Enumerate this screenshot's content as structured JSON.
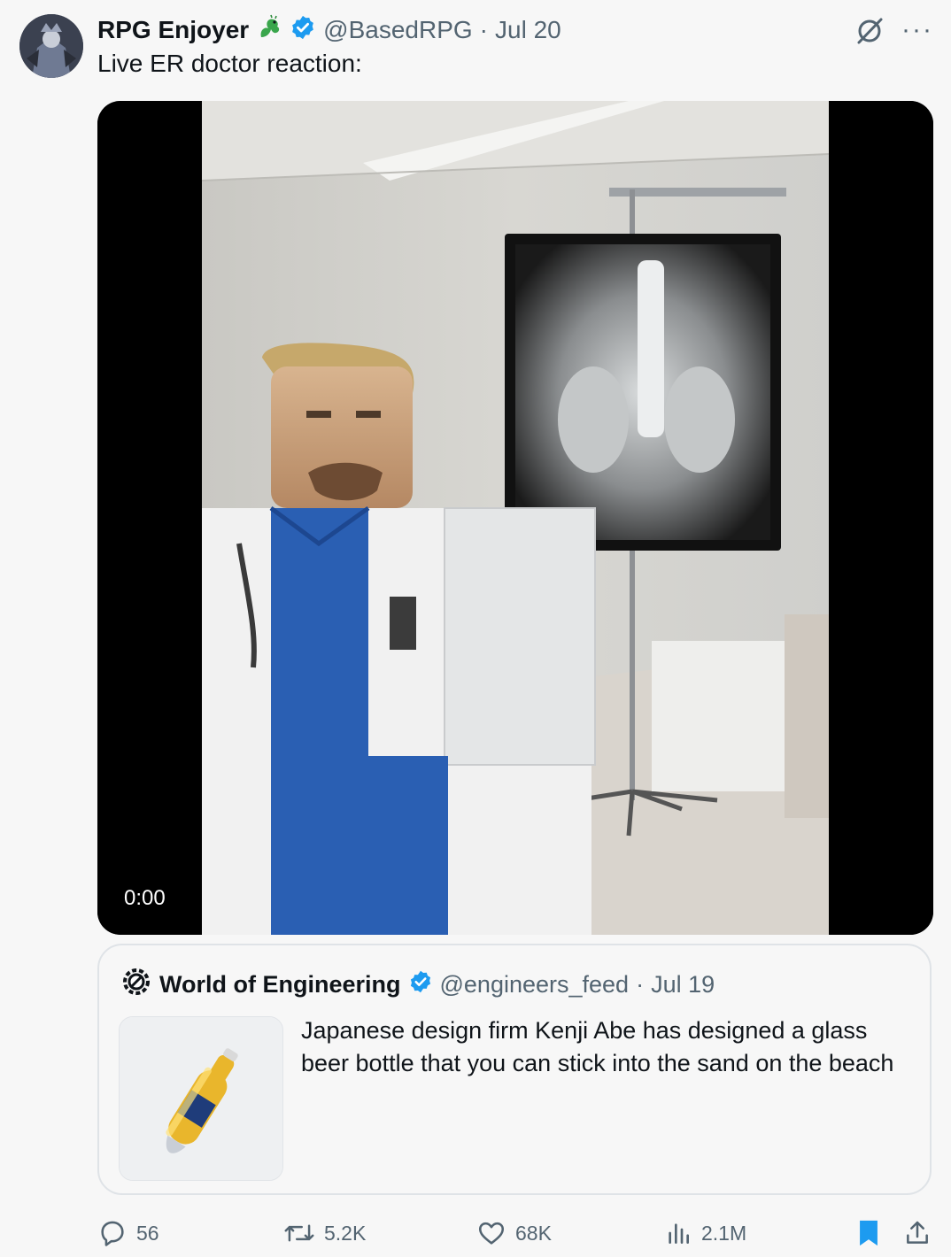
{
  "author": {
    "display_name": "RPG Enjoyer",
    "emoji_icon": "dragon-emoji",
    "verified_icon": "verified-badge-icon",
    "handle": "@BasedRPG",
    "separator": "·",
    "date": "Jul 20"
  },
  "tweet": {
    "text": "Live ER doctor reaction:"
  },
  "header_actions": {
    "grok_icon": "grok-icon",
    "more_label": "···"
  },
  "video": {
    "timestamp": "0:00"
  },
  "quote": {
    "display_name": "World of Engineering",
    "handle": "@engineers_feed",
    "separator": "·",
    "date": "Jul 19",
    "text": "Japanese design firm Kenji Abe has designed a glass beer bottle that you can stick into the sand on the beach"
  },
  "actions": {
    "replies": "56",
    "reposts": "5.2K",
    "likes": "68K",
    "views": "2.1M"
  },
  "colors": {
    "verified": "#1d9bf0",
    "bookmark": "#1d9bf0",
    "muted": "#536471"
  }
}
